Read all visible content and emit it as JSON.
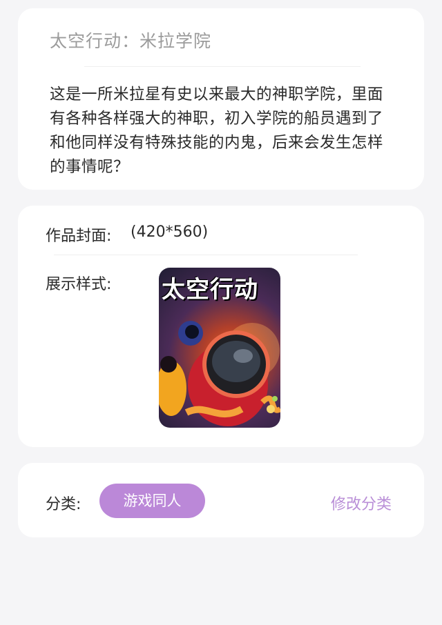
{
  "story": {
    "title": "太空行动：米拉学院",
    "description": "这是一所米拉星有史以来最大的神职学院，里面有各种各样强大的神职，初入学院的船员遇到了和他同样没有特殊技能的内鬼，后来会发生怎样的事情呢？"
  },
  "cover_section": {
    "label": "作品封面:",
    "size": "(420*560)",
    "style_label": "展示样式:",
    "cover_title": "太空行动"
  },
  "category_section": {
    "label": "分类:",
    "tag": "游戏同人",
    "edit": "修改分类"
  },
  "colors": {
    "accent": "#b98ed7",
    "tag_bg": "#bb88d8"
  }
}
